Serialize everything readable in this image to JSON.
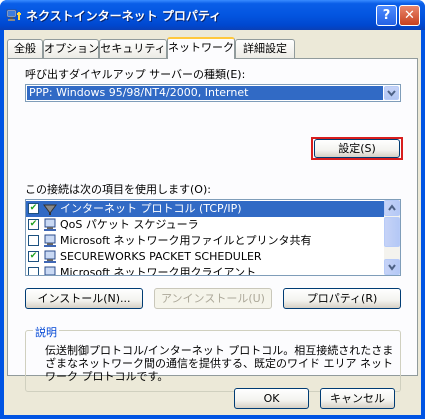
{
  "window": {
    "title": "ネクストインターネット プロパティ",
    "help_label": "?",
    "close_label": "✕"
  },
  "tabs": [
    {
      "label": "全般",
      "active": false
    },
    {
      "label": "オプション",
      "active": false
    },
    {
      "label": "セキュリティ",
      "active": false
    },
    {
      "label": "ネットワーク",
      "active": true
    },
    {
      "label": "詳細設定",
      "active": false
    }
  ],
  "network": {
    "dialup_type_label": "呼び出すダイヤルアップ サーバーの種類(E):",
    "dialup_type_value": "PPP: Windows 95/98/NT4/2000, Internet",
    "settings_button": "設定(S)",
    "components_label": "この接続は次の項目を使用します(O):",
    "components": [
      {
        "label": "インターネット プロトコル (TCP/IP)",
        "checked": true,
        "selected": true,
        "icon": "protocol-icon"
      },
      {
        "label": "QoS パケット スケジューラ",
        "checked": true,
        "selected": false,
        "icon": "service-icon"
      },
      {
        "label": "Microsoft ネットワーク用ファイルとプリンタ共有",
        "checked": false,
        "selected": false,
        "icon": "service-icon"
      },
      {
        "label": "SECUREWORKS PACKET SCHEDULER",
        "checked": true,
        "selected": false,
        "icon": "network-icon"
      },
      {
        "label": "Microsoft ネットワーク用クライアント",
        "checked": false,
        "selected": false,
        "icon": "network-icon"
      }
    ],
    "install_button": "インストール(N)...",
    "uninstall_button": "アンインストール(U)",
    "properties_button": "プロパティ(R)",
    "description_title": "説明",
    "description_text": "伝送制御プロトコル/インターネット プロトコル。相互接続されたさまざまなネットワーク間の通信を提供する、既定のワイド エリア ネットワーク プロトコルです。"
  },
  "footer": {
    "ok_button": "OK",
    "cancel_button": "キャンセル"
  },
  "colors": {
    "titlebar": "#0054e3",
    "selection": "#316ac5",
    "highlight_box": "#d81e1e",
    "group_title": "#0046d5"
  }
}
